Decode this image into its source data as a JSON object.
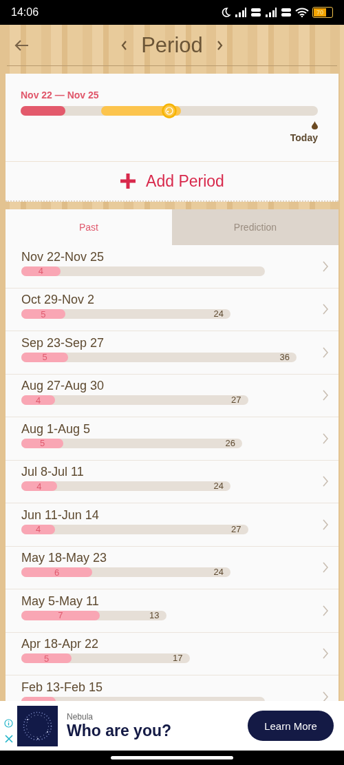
{
  "status_bar": {
    "time": "14:06",
    "battery": "70"
  },
  "header": {
    "title": "Period"
  },
  "current": {
    "range": "Nov 22 — Nov 25",
    "level": 0.15,
    "today": "Today"
  },
  "add_button": {
    "label": "Add Period"
  },
  "tabs": [
    {
      "label": "Past",
      "selected": true
    },
    {
      "label": "Prediction",
      "selected": false
    }
  ],
  "periods": [
    {
      "dates": "Nov 22-Nov 25",
      "days": "4",
      "level": 0.16
    },
    {
      "dates": "Oct 29-Nov 2",
      "days": "5",
      "cycle": "24",
      "level": 0.21
    },
    {
      "dates": "Sep 23-Sep 27",
      "days": "5",
      "cycle": "36",
      "level": 0.17
    },
    {
      "dates": "Aug 27-Aug 30",
      "days": "4",
      "cycle": "27",
      "level": 0.15
    },
    {
      "dates": "Aug 1-Aug 5",
      "days": "5",
      "cycle": "26",
      "level": 0.19
    },
    {
      "dates": "Jul 8-Jul 11",
      "days": "4",
      "cycle": "24",
      "level": 0.17
    },
    {
      "dates": "Jun 11-Jun 14",
      "days": "4",
      "cycle": "27",
      "level": 0.15
    },
    {
      "dates": "May 18-May 23",
      "days": "6",
      "cycle": "24",
      "level": 0.34
    },
    {
      "dates": "May 5-May 11",
      "days": "7",
      "cycle": "13",
      "level": 0.54
    },
    {
      "dates": "Apr 18-Apr 22",
      "days": "5",
      "cycle": "17",
      "level": 0.3
    },
    {
      "dates": "Feb 13-Feb 15",
      "level": 0.14
    }
  ],
  "ad": {
    "advertiser": "Nebula",
    "headline": "Who are you?",
    "button": "Learn More"
  }
}
